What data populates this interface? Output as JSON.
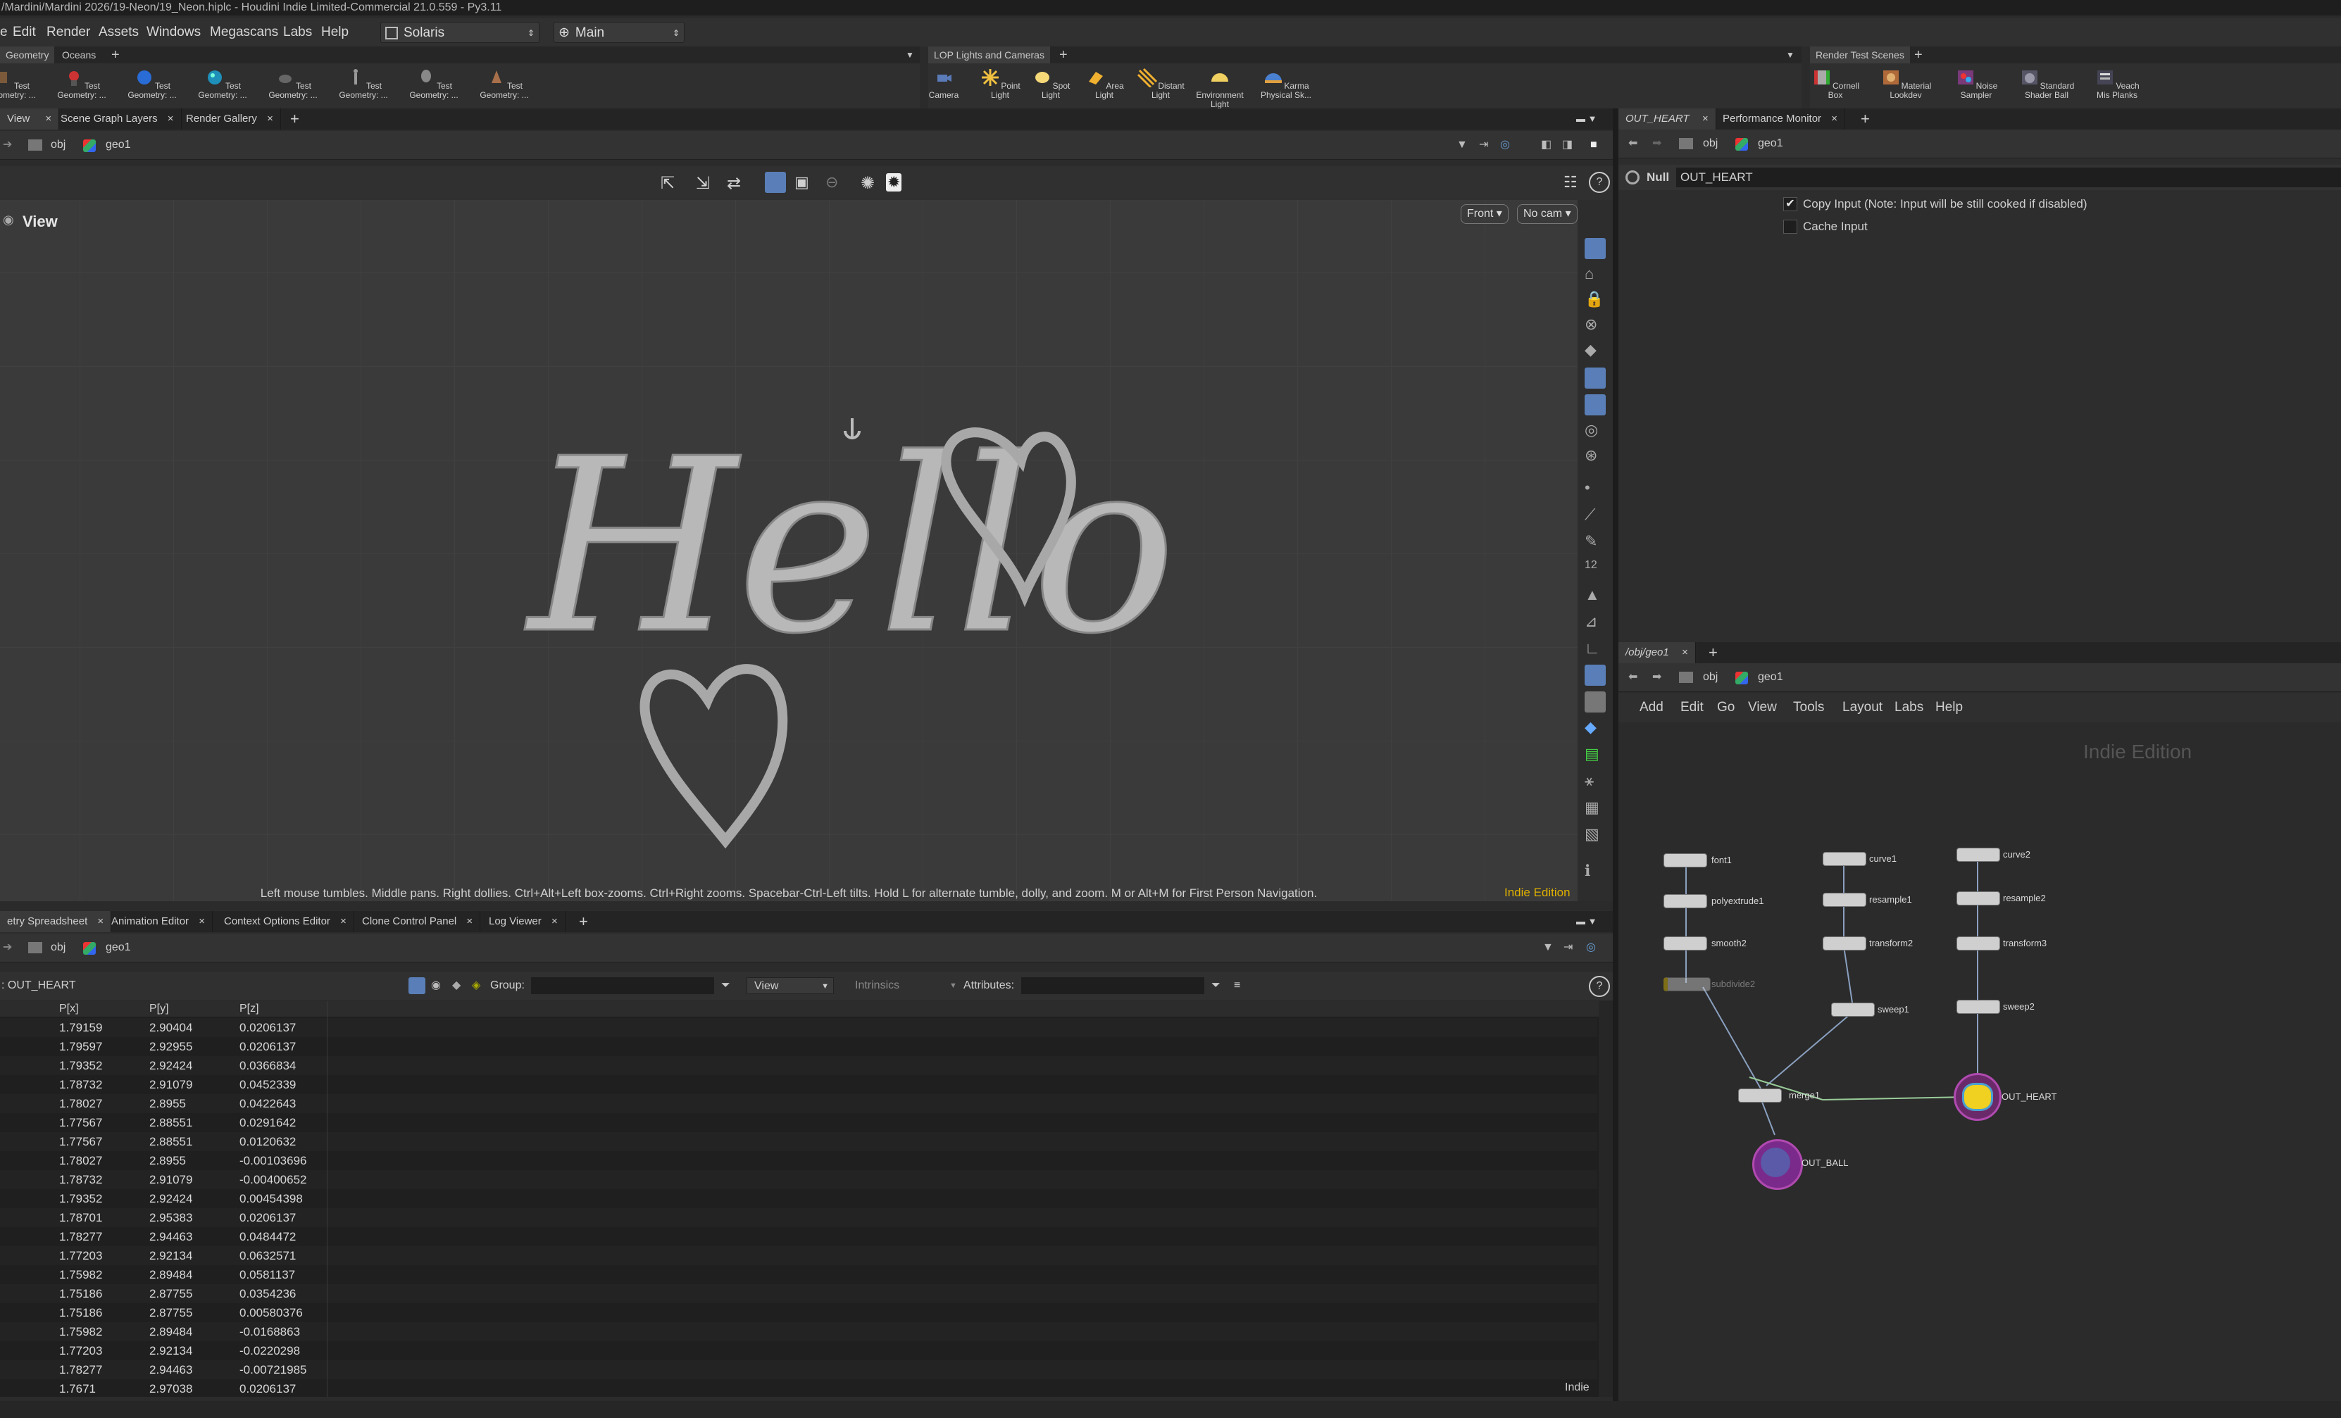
{
  "title_bar": "/Mardini/Mardini 2026/19-Neon/19_Neon.hiplc - Houdini Indie Limited-Commercial 21.0.559 - Py3.11",
  "menu": [
    "e",
    "Edit",
    "Render",
    "Assets",
    "Windows",
    "Megascans",
    "Labs",
    "Help"
  ],
  "desktop": "Solaris",
  "context": "Main",
  "shelf_left": {
    "tabs": [
      "Geometry",
      "Oceans"
    ],
    "tools": [
      {
        "label": "Test Geometry: ...",
        "icon": "test-geometry-icon"
      },
      {
        "label": "Test Geometry: ...",
        "icon": "crag-icon"
      },
      {
        "label": "Test Geometry: ...",
        "icon": "sphere-icon"
      },
      {
        "label": "Test Geometry: ...",
        "icon": "globe-icon"
      },
      {
        "label": "Test Geometry: ...",
        "icon": "pig-icon"
      },
      {
        "label": "Test Geometry: ...",
        "icon": "figure-icon"
      },
      {
        "label": "Test Geometry: ...",
        "icon": "head-icon"
      },
      {
        "label": "Test Geometry: ...",
        "icon": "squab-icon"
      }
    ]
  },
  "shelf_mid": {
    "tab": "LOP Lights and Cameras",
    "tools": [
      "Camera",
      "Point Light",
      "Spot Light",
      "Area Light",
      "Distant Light",
      "Environment Light",
      "Karma Physical Sk..."
    ]
  },
  "shelf_right": {
    "tab": "Render Test Scenes",
    "tools": [
      "Cornell Box",
      "Material Lookdev",
      "Noise Sampler",
      "Standard Shader Ball",
      "Veach Mis Planks"
    ]
  },
  "viewer_tabs": [
    "View",
    "Scene Graph Layers",
    "Render Gallery"
  ],
  "path": {
    "obj": "obj",
    "geo": "geo1"
  },
  "viewport": {
    "label": "View",
    "front_btn": "Front",
    "cam_btn": "No cam",
    "hello_text": "Hello",
    "status": "Left mouse tumbles. Middle pans. Right dollies. Ctrl+Alt+Left box-zooms. Ctrl+Right zooms. Spacebar-Ctrl-Left tilts. Hold L for alternate tumble, dolly, and zoom. M or Alt+M for First Person Navigation.",
    "edition": "Indie Edition"
  },
  "param_tabs": [
    "OUT_HEART",
    "Performance Monitor"
  ],
  "params": {
    "type": "Null",
    "name": "OUT_HEART",
    "copy_input": "Copy Input (Note: Input will be still cooked if disabled)",
    "cache_input": "Cache Input"
  },
  "bottom_tabs": [
    "etry Spreadsheet",
    "Animation Editor",
    "Context Options Editor",
    "Clone Control Panel",
    "Log Viewer"
  ],
  "spreadsheet": {
    "node": ": OUT_HEART",
    "group_label": "Group:",
    "view_label": "View",
    "intrinsics": "Intrinsics",
    "attributes_label": "Attributes:",
    "columns": [
      "P[x]",
      "P[y]",
      "P[z]"
    ],
    "rows": [
      [
        "1.79159",
        "2.90404",
        "0.0206137"
      ],
      [
        "1.79597",
        "2.92955",
        "0.0206137"
      ],
      [
        "1.79352",
        "2.92424",
        "0.0366834"
      ],
      [
        "1.78732",
        "2.91079",
        "0.0452339"
      ],
      [
        "1.78027",
        "2.8955",
        "0.0422643"
      ],
      [
        "1.77567",
        "2.88551",
        "0.0291642"
      ],
      [
        "1.77567",
        "2.88551",
        "0.0120632"
      ],
      [
        "1.78027",
        "2.8955",
        "-0.00103696"
      ],
      [
        "1.78732",
        "2.91079",
        "-0.00400652"
      ],
      [
        "1.79352",
        "2.92424",
        "0.00454398"
      ],
      [
        "1.78701",
        "2.95383",
        "0.0206137"
      ],
      [
        "1.78277",
        "2.94463",
        "0.0484472"
      ],
      [
        "1.77203",
        "2.92134",
        "0.0632571"
      ],
      [
        "1.75982",
        "2.89484",
        "0.0581137"
      ],
      [
        "1.75186",
        "2.87755",
        "0.0354236"
      ],
      [
        "1.75186",
        "2.87755",
        "0.00580376"
      ],
      [
        "1.75982",
        "2.89484",
        "-0.0168863"
      ],
      [
        "1.77203",
        "2.92134",
        "-0.0220298"
      ],
      [
        "1.78277",
        "2.94463",
        "-0.00721985"
      ],
      [
        "1.7671",
        "2.97038",
        "0.0206137"
      ]
    ],
    "footer": "Indie"
  },
  "network": {
    "tab": "/obj/geo1",
    "menu": [
      "Add",
      "Edit",
      "Go",
      "View",
      "Tools",
      "Layout",
      "Labs",
      "Help"
    ],
    "watermark": "Indie Edition",
    "nodes": [
      "font1",
      "polyextrude1",
      "smooth2",
      "subdivide2",
      "curve1",
      "resample1",
      "transform2",
      "sweep1",
      "curve2",
      "resample2",
      "transform3",
      "sweep2",
      "merge1",
      "OUT_HEART",
      "OUT_BALL"
    ]
  }
}
